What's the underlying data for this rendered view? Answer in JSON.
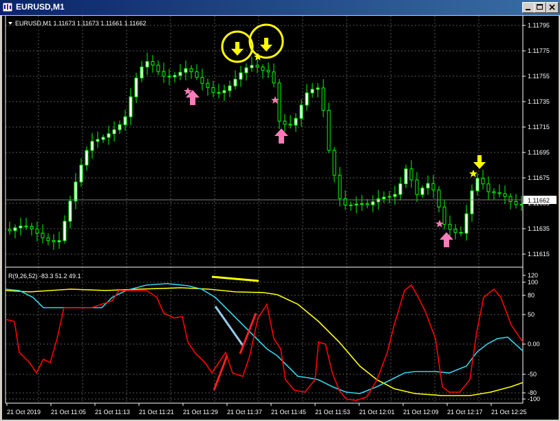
{
  "window": {
    "title": "EURUSD,M1"
  },
  "chart": {
    "header": "EURUSD,M1  1.11673 1.11673 1.11661 1.11662",
    "current_price": "1.11662",
    "price_labels": [
      "1.11795",
      "1.11775",
      "1.11755",
      "1.11735",
      "1.11715",
      "1.11695",
      "1.11675",
      "1.11655",
      "1.11635",
      "1.11615"
    ],
    "time_labels": [
      "21 Oct 2019",
      "21 Oct 11:05",
      "21 Oct 11:13",
      "21 Oct 11:21",
      "21 Oct 11:29",
      "21 Oct 11:37",
      "21 Oct 11:45",
      "21 Oct 11:53",
      "21 Oct 12:01",
      "21 Oct 12:09",
      "21 Oct 12:17",
      "21 Oct 12:25"
    ],
    "colors": {
      "bull": "#ffffff",
      "bear": "#000000",
      "outline": "#00ff00",
      "grid": "#5a5a5a",
      "yellow": "#ffff00",
      "pink": "#ff7ab8",
      "red": "#ff0000",
      "cyan": "#33d6ee",
      "lightblue": "#99ccee"
    }
  },
  "indicator": {
    "header": "R(9,26,52) -83.3 51.2 49.1",
    "levels": [
      "120",
      "100",
      "80",
      "50",
      "0.00",
      "-50",
      "-80",
      "-100"
    ]
  }
}
